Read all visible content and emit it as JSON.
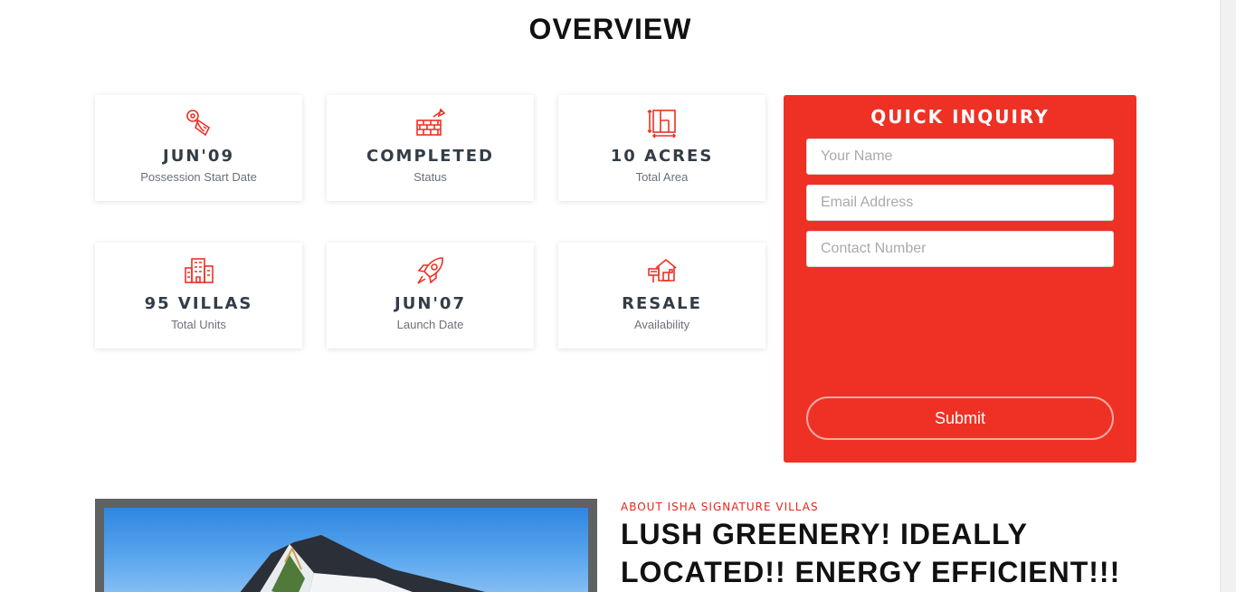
{
  "overview": {
    "title": "OVERVIEW",
    "cards": [
      {
        "value": "JUN'09",
        "label": "Possession Start Date",
        "icon": "key-tag-icon"
      },
      {
        "value": "COMPLETED",
        "label": "Status",
        "icon": "brick-wall-trowel-icon"
      },
      {
        "value": "10 ACRES",
        "label": "Total Area",
        "icon": "floor-plan-icon"
      },
      {
        "value": "95 VILLAS",
        "label": "Total Units",
        "icon": "buildings-icon"
      },
      {
        "value": "JUN'07",
        "label": "Launch Date",
        "icon": "rocket-icon"
      },
      {
        "value": "RESALE",
        "label": "Availability",
        "icon": "house-sale-sign-icon"
      }
    ]
  },
  "inquiry": {
    "title": "QUICK INQUIRY",
    "name_placeholder": "Your Name",
    "email_placeholder": "Email Address",
    "phone_placeholder": "Contact Number",
    "submit_label": "Submit"
  },
  "about": {
    "kicker": "ABOUT ISHA SIGNATURE VILLAS",
    "heading": "LUSH GREENERY! IDEALLY LOCATED!! ENERGY EFFICIENT!!!"
  },
  "colors": {
    "accent": "#ee3124",
    "heading_text": "#333d47",
    "muted_text": "#6b7178"
  }
}
